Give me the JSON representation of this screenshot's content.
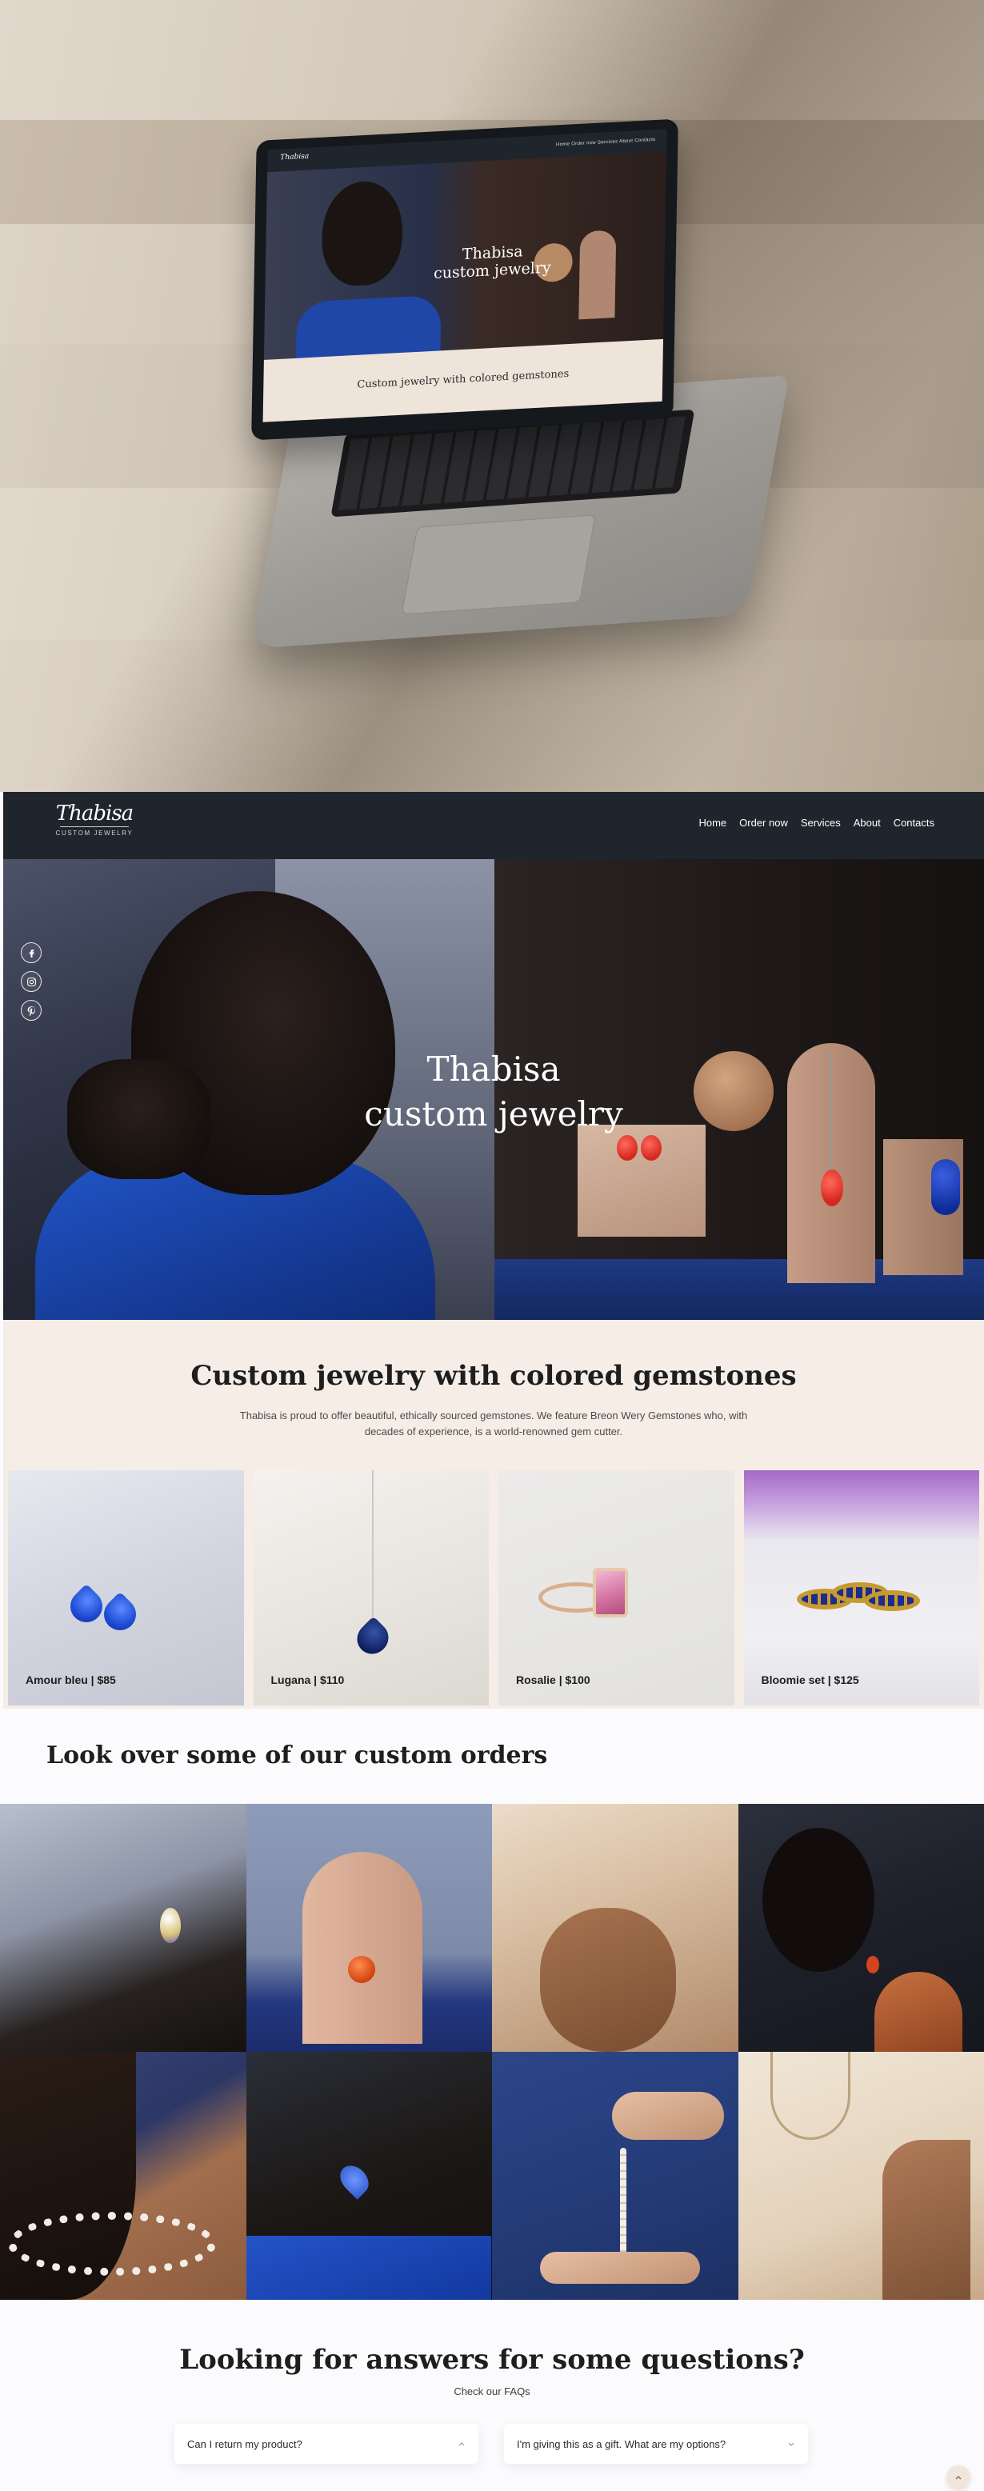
{
  "mockup": {
    "laptop_logo": "Thabisa",
    "laptop_nav": "Home  Order now  Services  About  Contacts",
    "laptop_hero_title_line1": "Thabisa",
    "laptop_hero_title_line2": "custom jewelry",
    "laptop_bottom_text": "Custom jewelry with colored gemstones"
  },
  "navbar": {
    "logo_script": "Thabisa",
    "logo_sub": "CUSTOM JEWELRY",
    "links": [
      "Home",
      "Order now",
      "Services",
      "About",
      "Contacts"
    ]
  },
  "social": {
    "icons": [
      "facebook-icon",
      "instagram-icon",
      "pinterest-icon"
    ]
  },
  "hero": {
    "title_line1": "Thabisa",
    "title_line2": "custom jewelry"
  },
  "intro": {
    "title": "Custom jewelry with colored gemstones",
    "text": "Thabisa is proud to offer beautiful, ethically sourced gemstones. We feature Breon Wery Gemstones who, with decades of experience, is a world-renowned gem cutter."
  },
  "products": [
    {
      "label": "Amour bleu | $85"
    },
    {
      "label": "Lugana | $110"
    },
    {
      "label": "Rosalie | $100"
    },
    {
      "label": "Bloomie set | $125"
    }
  ],
  "orders": {
    "title": "Look over some of our custom orders"
  },
  "faq": {
    "title": "Looking for answers for some questions?",
    "subtitle": "Check our FAQs",
    "items": [
      {
        "question": "Can I return my product?"
      },
      {
        "question": "I'm giving this as a gift. What are my options?"
      }
    ]
  },
  "colors": {
    "navbar_bg": "#1f252c",
    "intro_bg": "#f6ede6",
    "page_bg": "#fbfbfd"
  }
}
